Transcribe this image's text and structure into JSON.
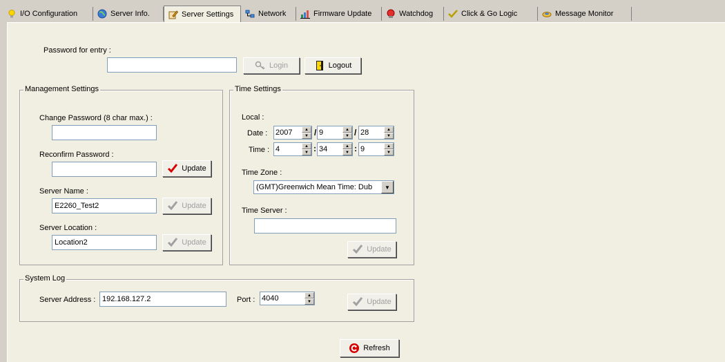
{
  "tabs": [
    {
      "label": "I/O Configuration",
      "icon": "bulb-icon"
    },
    {
      "label": "Server Info.",
      "icon": "globe-icon"
    },
    {
      "label": "Server Settings",
      "icon": "settings-pencil-icon",
      "active": true
    },
    {
      "label": "Network",
      "icon": "network-icon"
    },
    {
      "label": "Firmware Update",
      "icon": "chart-icon"
    },
    {
      "label": "Watchdog",
      "icon": "watchdog-icon"
    },
    {
      "label": "Click & Go Logic",
      "icon": "check-icon"
    },
    {
      "label": "Message Monitor",
      "icon": "monitor-icon"
    }
  ],
  "login": {
    "password_label": "Password for entry :",
    "password_value": "",
    "login_button": "Login",
    "logout_button": "Logout"
  },
  "management": {
    "title": "Management Settings",
    "change_password_label": "Change Password (8 char max.) :",
    "change_password_value": "",
    "reconfirm_label": "Reconfirm Password :",
    "reconfirm_value": "",
    "update_button": "Update",
    "server_name_label": "Server Name :",
    "server_name_value": "E2260_Test2",
    "server_location_label": "Server Location :",
    "server_location_value": "Location2"
  },
  "time": {
    "title": "Time Settings",
    "local_label": "Local :",
    "date_label": "Date :",
    "date_year": "2007",
    "date_month": "9",
    "date_day": "28",
    "time_label": "Time :",
    "time_hour": "4",
    "time_minute": "34",
    "time_second": "9",
    "timezone_label": "Time Zone :",
    "timezone_value": "(GMT)Greenwich Mean Time: Dub",
    "timeserver_label": "Time Server :",
    "timeserver_value": "",
    "update_button": "Update",
    "date_sep": "/",
    "time_sep": ":"
  },
  "syslog": {
    "title": "System Log",
    "server_address_label": "Server Address :",
    "server_address_value": "192.168.127.2",
    "port_label": "Port :",
    "port_value": "4040",
    "update_button": "Update"
  },
  "refresh_button": "Refresh",
  "colors": {
    "check_enabled": "#d40000",
    "check_disabled": "#a0a0a0"
  }
}
